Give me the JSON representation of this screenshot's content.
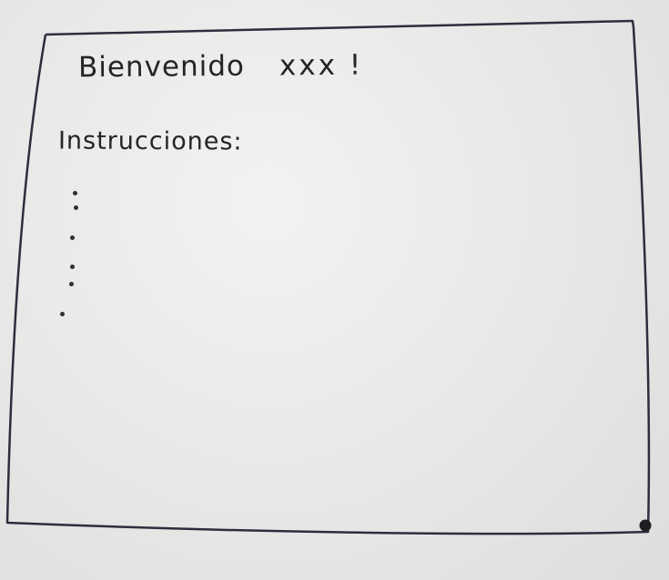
{
  "screen": {
    "greeting_prefix": "Bienvenido",
    "greeting_name": "xxx !",
    "instructions_label": "Instrucciones:"
  },
  "instructions": {
    "bullet_count": 5
  },
  "colors": {
    "ink": "#2b2a2c",
    "paper": "#ecebea"
  }
}
